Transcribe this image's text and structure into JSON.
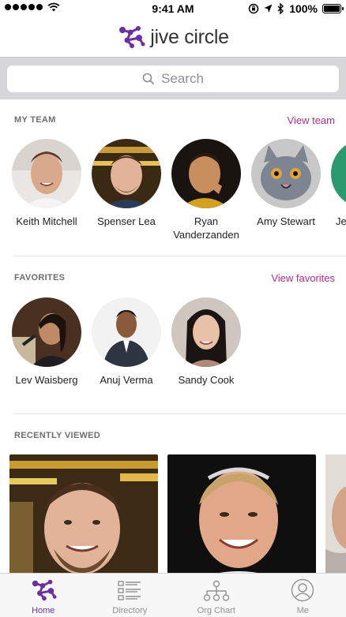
{
  "status_bar": {
    "time": "9:41 AM",
    "battery": "100%",
    "battery_level": 1.0,
    "icons": [
      "signal-dots-icon",
      "wifi-icon",
      "orientation-lock-icon",
      "location-arrow-icon",
      "bluetooth-icon",
      "battery-icon"
    ]
  },
  "header": {
    "app_title": "jive circle",
    "brand_color": "#6b2fa0"
  },
  "search": {
    "placeholder": "Search"
  },
  "my_team": {
    "title": "MY TEAM",
    "link": "View team",
    "members": [
      {
        "name": "Keith Mitchell"
      },
      {
        "name": "Spenser Lea"
      },
      {
        "name": "Ryan Vanderzanden"
      },
      {
        "name": "Amy Stewart"
      },
      {
        "name": "Je"
      }
    ]
  },
  "favorites": {
    "title": "FAVORITES",
    "link": "View favorites",
    "members": [
      {
        "name": "Lev Waisberg"
      },
      {
        "name": "Anuj Verma"
      },
      {
        "name": "Sandy Cook"
      }
    ]
  },
  "recently_viewed": {
    "title": "RECENTLY VIEWED"
  },
  "tabs": [
    {
      "label": "Home",
      "icon": "jive-circle-icon",
      "active": true
    },
    {
      "label": "Directory",
      "icon": "directory-list-icon",
      "active": false
    },
    {
      "label": "Org Chart",
      "icon": "org-chart-icon",
      "active": false
    },
    {
      "label": "Me",
      "icon": "profile-icon",
      "active": false
    }
  ],
  "colors": {
    "accent": "#b12a8f",
    "brand": "#6b2fa0",
    "tab_inactive": "#929292"
  }
}
